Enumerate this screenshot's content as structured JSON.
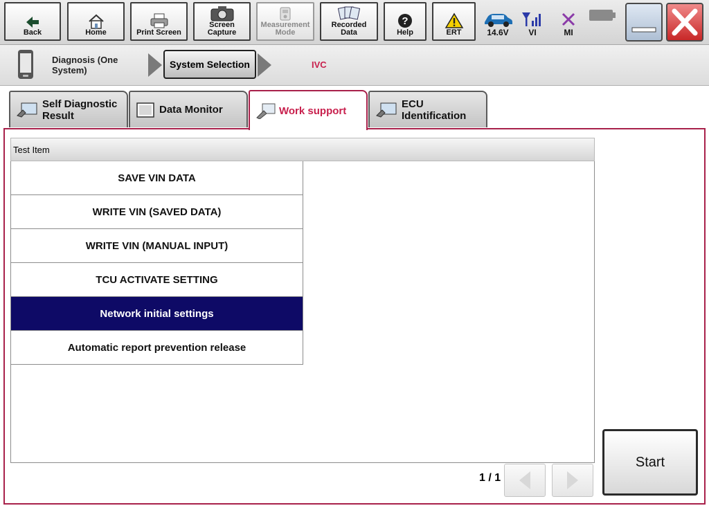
{
  "toolbar": {
    "back": "Back",
    "home": "Home",
    "print_screen": "Print Screen",
    "screen_capture_1": "Screen",
    "screen_capture_2": "Capture",
    "measurement_1": "Measurement",
    "measurement_2": "Mode",
    "recorded_1": "Recorded",
    "recorded_2": "Data",
    "help": "Help",
    "ert": "ERT"
  },
  "status": {
    "voltage": "14.6V",
    "vi": "VI",
    "mi": "MI"
  },
  "breadcrumb": {
    "step1_line1": "Diagnosis (One",
    "step1_line2": "System)",
    "step2": "System Selection",
    "step3": "IVC"
  },
  "tabs": [
    {
      "line1": "Self Diagnostic",
      "line2": "Result"
    },
    {
      "line1": "Data Monitor"
    },
    {
      "line1": "Work support"
    },
    {
      "line1": "ECU",
      "line2": "Identification"
    }
  ],
  "list": {
    "header": "Test Item",
    "items": [
      "SAVE VIN DATA",
      "WRITE VIN (SAVED DATA)",
      "WRITE VIN (MANUAL INPUT)",
      "TCU ACTIVATE SETTING",
      "Network initial settings",
      "Automatic report prevention release"
    ],
    "selected_index": 4
  },
  "pager": "1 / 1",
  "start_button": "Start",
  "colors": {
    "accent": "#a8204a",
    "active_tab_text": "#c8204d",
    "selected_row": "#0e0a66",
    "ivc_text": "#c8204d"
  }
}
